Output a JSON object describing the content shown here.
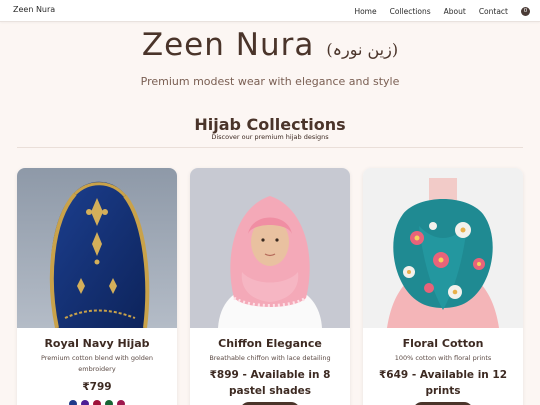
{
  "navbar": {
    "brand": "Zeen Nura",
    "links": [
      "Home",
      "Collections",
      "About",
      "Contact"
    ],
    "cart_count": "0"
  },
  "hero": {
    "title": "Zeen Nura",
    "title_urdu": "(زین نورہ)",
    "subtitle": "Premium modest wear with elegance and style"
  },
  "section": {
    "title": "Hijab Collections",
    "subtitle": "Discover our premium hijab designs"
  },
  "products": [
    {
      "name": "Royal Navy Hijab",
      "description": "Premium cotton blend with golden embroidery",
      "price": "₹799",
      "color_swatches": [
        "#1e3a8a",
        "#4c1d95",
        "#9f1239",
        "#166534",
        "#9d174d"
      ]
    },
    {
      "name": "Chiffon Elegance",
      "description": "Breathable chiffon with lace detailing",
      "price": "₹899 - Available in 8 pastel shades"
    },
    {
      "name": "Floral Cotton",
      "description": "100% cotton with floral prints",
      "price": "₹649 - Available in 12 prints"
    }
  ],
  "theme": {
    "background": "#fcf6f3",
    "accent_brown": "#4a342a"
  }
}
